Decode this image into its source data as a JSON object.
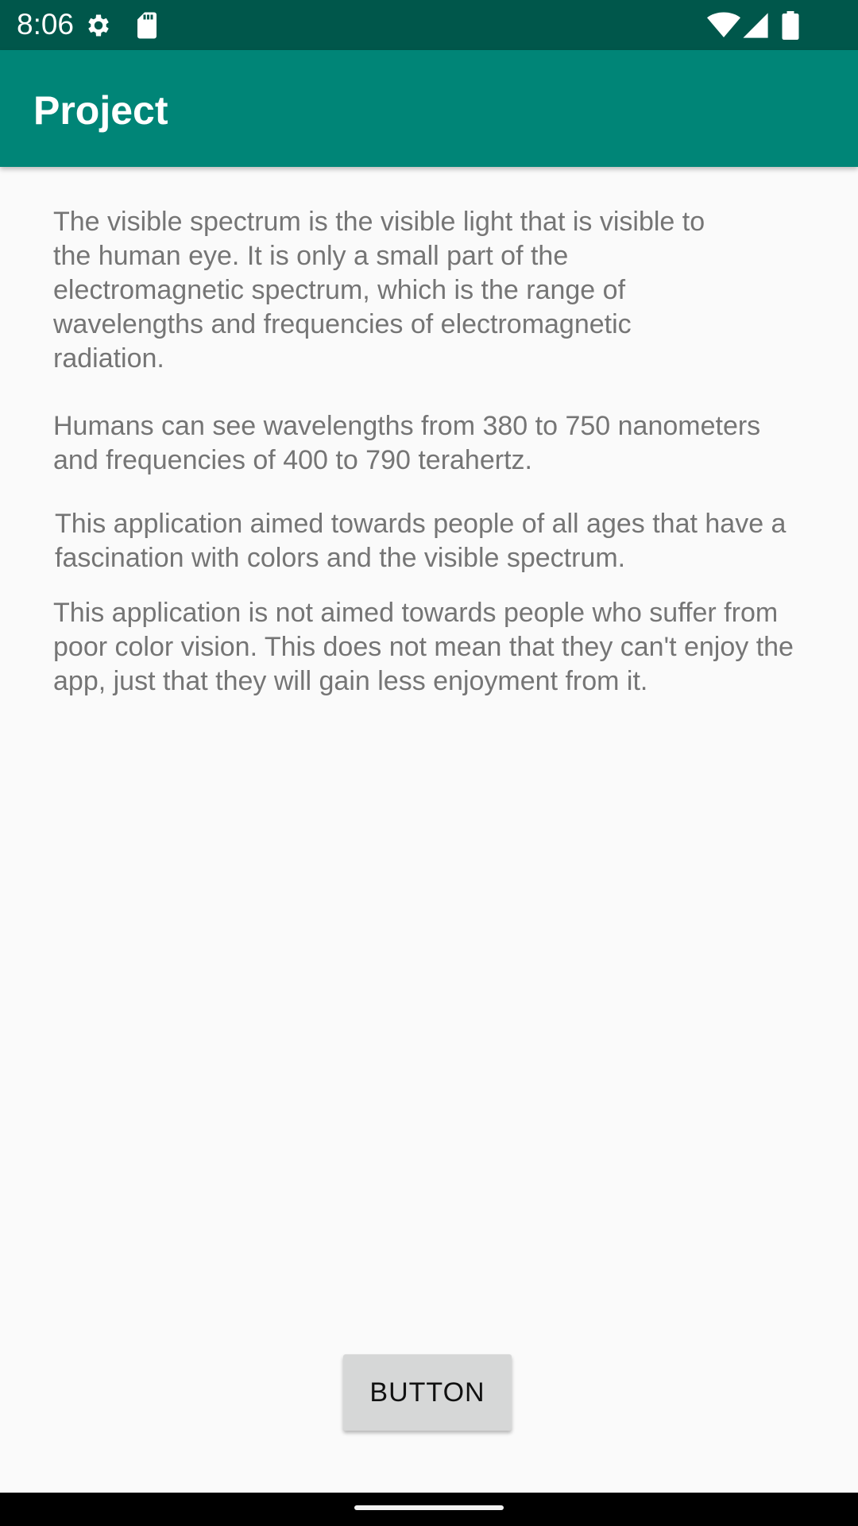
{
  "status_bar": {
    "time": "8:06",
    "icons": [
      "gear-icon",
      "sd-card-icon",
      "wifi-icon",
      "signal-icon",
      "battery-icon"
    ]
  },
  "app_bar": {
    "title": "Project"
  },
  "content": {
    "paragraphs": [
      "The visible spectrum is the visible light that is visible to the human eye. It is only a small part of the electromagnetic spectrum, which is the range of wavelengths and frequencies of electromagnetic radiation.",
      "Humans can see wavelengths from 380 to 750 nanometers and frequencies of 400 to 790 terahertz.",
      "This application aimed towards people of all ages that have a fascination with colors and the visible spectrum.",
      "This application is not aimed towards people who suffer from poor color vision. This does not mean that they can't enjoy the app, just that they will gain less enjoyment from it."
    ]
  },
  "button": {
    "label": "BUTTON"
  },
  "colors": {
    "status_bar": "#00574b",
    "app_bar": "#008577",
    "background": "#fafafa",
    "body_text": "#757575",
    "button_bg": "#d6d7d7"
  }
}
